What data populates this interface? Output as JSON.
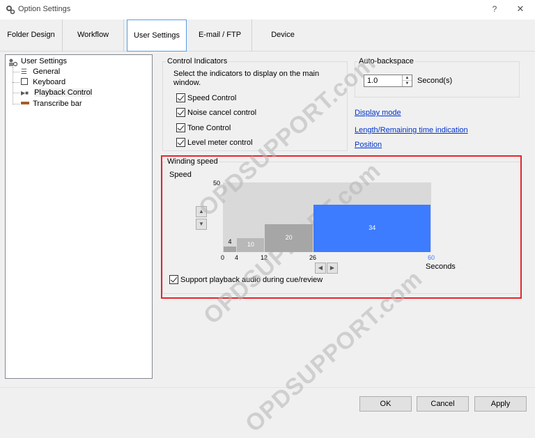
{
  "window": {
    "title": "Option Settings",
    "help_glyph": "?",
    "close_glyph": "✕"
  },
  "tabs": [
    {
      "label": "Folder Design",
      "active": false
    },
    {
      "label": "Workflow",
      "active": false
    },
    {
      "label": "User Settings",
      "active": true
    },
    {
      "label": "E-mail / FTP",
      "active": false
    },
    {
      "label": "Device",
      "active": false
    }
  ],
  "tree": {
    "root": {
      "label": "User Settings",
      "icon": "user-settings-icon"
    },
    "children": [
      {
        "label": "General",
        "icon": "list-icon"
      },
      {
        "label": "Keyboard",
        "icon": "keyboard-icon"
      },
      {
        "label": "Playback Control",
        "icon": "playback-icon",
        "selected": true
      },
      {
        "label": "Transcribe bar",
        "icon": "transcribe-bar-icon"
      }
    ]
  },
  "control_indicators": {
    "title": "Control Indicators",
    "description": "Select the indicators to display on the main window.",
    "items": [
      {
        "label": "Speed Control",
        "checked": true
      },
      {
        "label": "Noise cancel control",
        "checked": true
      },
      {
        "label": "Tone Control",
        "checked": true
      },
      {
        "label": "Level meter control",
        "checked": true
      }
    ]
  },
  "auto_backspace": {
    "title": "Auto-backspace",
    "value": "1.0",
    "unit": "Second(s)"
  },
  "links": {
    "display_mode": "Display mode",
    "length_indication": "Length/Remaining time indication",
    "position": "Position"
  },
  "winding_speed": {
    "title": "Winding speed",
    "support_playback_label": "Support playback audio during cue/review",
    "support_playback_checked": true
  },
  "chart_data": {
    "type": "bar",
    "ylabel": "Speed",
    "xlabel": "Seconds",
    "ylim": [
      0,
      50
    ],
    "xlim": [
      0,
      60
    ],
    "y_tick_labels": [
      "50"
    ],
    "x_tick_labels": [
      "0",
      "4",
      "12",
      "26",
      "60"
    ],
    "bars": [
      {
        "x_start": 0,
        "x_end": 4,
        "value": 4,
        "color": "#a6a6a6"
      },
      {
        "x_start": 4,
        "x_end": 12,
        "value": 10,
        "color": "#b8b8b8"
      },
      {
        "x_start": 12,
        "x_end": 26,
        "value": 20,
        "color": "#a6a6a6"
      },
      {
        "x_start": 26,
        "x_end": 60,
        "value": 34,
        "color": "#3d7bff"
      }
    ],
    "highlight_color": "#3d7bff"
  },
  "buttons": {
    "ok": "OK",
    "cancel": "Cancel",
    "apply": "Apply"
  },
  "watermark": "OPDSUPPORT.com"
}
